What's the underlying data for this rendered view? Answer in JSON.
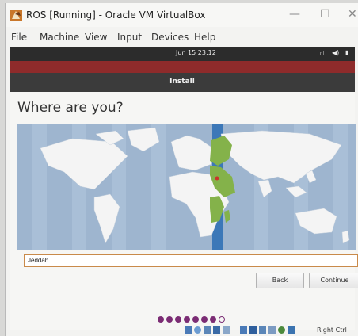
{
  "window": {
    "title": "ROS [Running] - Oracle VM VirtualBox",
    "controls": {
      "minimize": "—",
      "maximize": "☐",
      "close": "✕"
    }
  },
  "menu": [
    "File",
    "Machine",
    "View",
    "Input",
    "Devices",
    "Help"
  ],
  "panel": {
    "clock": "Jun 15  23:12",
    "icons": [
      "network-icon",
      "volume-icon",
      "battery-icon"
    ]
  },
  "installer": {
    "header": "Install",
    "title": "Where are you?",
    "location_value": "Jeddah",
    "back_label": "Back",
    "continue_label": "Continue",
    "progress": {
      "total_steps": 8,
      "completed_steps": 7
    }
  },
  "statusbar": {
    "host_key": "Right Ctrl"
  },
  "colors": {
    "panel": "#2c2c2c",
    "red_band": "#8e2b2b",
    "header": "#3b3b3b",
    "map_ocean": "#9eb5cf",
    "selected_timezone": "#84b24a",
    "timezone_stripe": "#3c78b8",
    "accent_purple": "#7b2c74"
  }
}
